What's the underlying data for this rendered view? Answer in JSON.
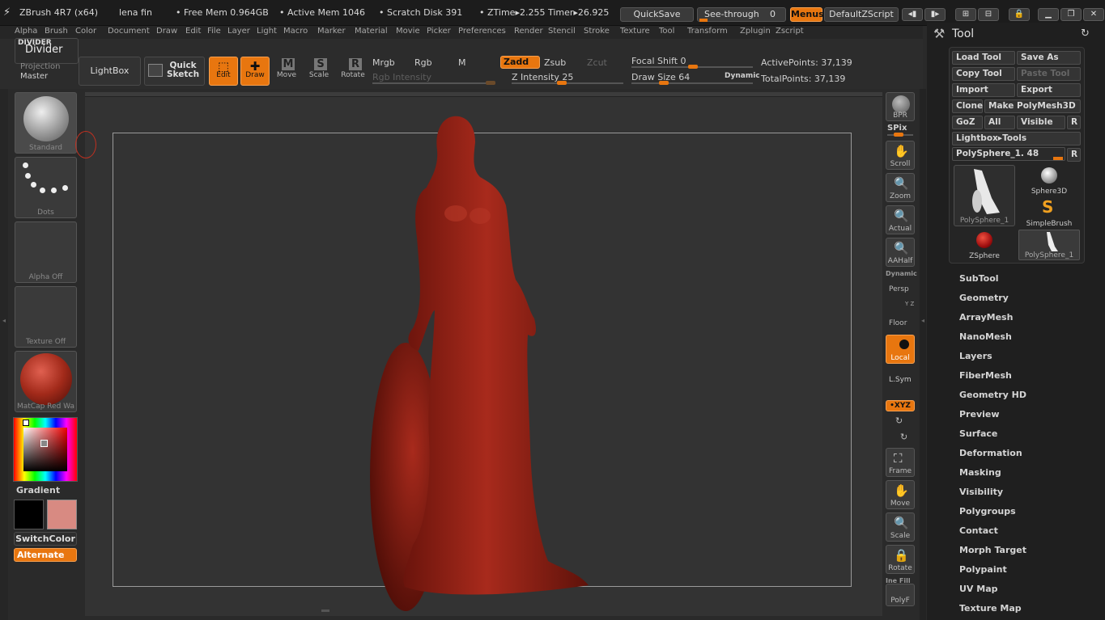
{
  "titlebar": {
    "app": "ZBrush 4R7 (x64)",
    "file": "lena fin",
    "free_mem": "• Free Mem 0.964GB",
    "active_mem": "• Active Mem 1046",
    "scratch": "• Scratch Disk 391",
    "ztime": "• ZTime▸2.255 Timer▸26.925",
    "quicksave": "QuickSave",
    "see_through": "See-through",
    "see_through_value": "0",
    "menus": "Menus",
    "default_script": "DefaultZScript"
  },
  "menubar": [
    "Alpha",
    "Brush",
    "Color",
    "Document",
    "Draw",
    "Edit",
    "File",
    "Layer",
    "Light",
    "Macro",
    "Marker",
    "Material",
    "Movie",
    "Picker",
    "Preferences",
    "Render",
    "Stencil",
    "Stroke",
    "Texture",
    "Tool",
    "Transform",
    "Zplugin",
    "Zscript"
  ],
  "shelf": {
    "divider_small": "DIVIDER",
    "divider": "Divider",
    "projection": "Projection",
    "master": "Master",
    "lightbox": "LightBox",
    "quick": "Quick",
    "sketch": "Sketch",
    "edit": "Edit",
    "draw": "Draw",
    "move": "Move",
    "scale": "Scale",
    "rotate": "Rotate",
    "mrgb": "Mrgb",
    "rgb": "Rgb",
    "m": "M",
    "zadd": "Zadd",
    "zsub": "Zsub",
    "zcut": "Zcut",
    "rgb_intensity": "Rgb Intensity",
    "z_intensity": "Z Intensity 25",
    "focal_shift": "Focal Shift 0",
    "draw_size": "Draw Size 64",
    "dynamic": "Dynamic",
    "active_points": "ActivePoints: 37,139",
    "total_points": "TotalPoints: 37,139"
  },
  "left": {
    "standard": "Standard",
    "dots": "Dots",
    "alpha_off": "Alpha Off",
    "texture_off": "Texture Off",
    "matcap": "MatCap Red Wa",
    "gradient": "Gradient",
    "switchcolor": "SwitchColor",
    "alternate": "Alternate",
    "main_color": "#000000",
    "secondary_color": "#d88a82"
  },
  "right": {
    "bpr": "BPR",
    "spix": "SPix",
    "scroll": "Scroll",
    "zoom": "Zoom",
    "actual": "Actual",
    "aahalf": "AAHalf",
    "dynamic": "Dynamic",
    "persp": "Persp",
    "floor": "Floor",
    "local": "Local",
    "lsym": "L.Sym",
    "xyz": "•XYZ",
    "frame": "Frame",
    "move": "Move",
    "scale": "Scale",
    "rotate": "Rotate",
    "inefill": "Ine Fill",
    "polyf": "PolyF"
  },
  "tool": {
    "title": "Tool",
    "load_tool": "Load Tool",
    "save_as": "Save As",
    "copy_tool": "Copy Tool",
    "paste_tool": "Paste Tool",
    "import": "Import",
    "export": "Export",
    "clone": "Clone",
    "make_polymesh": "Make PolyMesh3D",
    "goz": "GoZ",
    "all": "All",
    "visible": "Visible",
    "r": "R",
    "lightbox_tools": "Lightbox▸Tools",
    "current_tool": "PolySphere_1. 48",
    "thumbs": [
      "PolySphere_1",
      "Sphere3D",
      "SimpleBrush",
      "ZSphere",
      "PolySphere_1"
    ],
    "sections": [
      "SubTool",
      "Geometry",
      "ArrayMesh",
      "NanoMesh",
      "Layers",
      "FiberMesh",
      "Geometry HD",
      "Preview",
      "Surface",
      "Deformation",
      "Masking",
      "Visibility",
      "Polygroups",
      "Contact",
      "Morph Target",
      "Polypaint",
      "UV Map",
      "Texture Map"
    ]
  },
  "colors": {
    "accent": "#e8760f",
    "model": "#9c2418"
  }
}
